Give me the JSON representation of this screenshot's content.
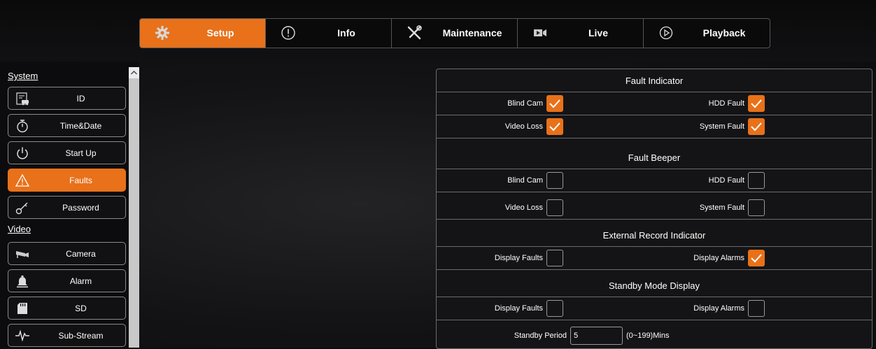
{
  "nav": {
    "tabs": [
      {
        "label": "Setup",
        "icon": "gear-icon",
        "active": true
      },
      {
        "label": "Info",
        "icon": "info-icon",
        "active": false
      },
      {
        "label": "Maintenance",
        "icon": "tools-icon",
        "active": false
      },
      {
        "label": "Live",
        "icon": "video-camera-icon",
        "active": false
      },
      {
        "label": "Playback",
        "icon": "play-icon",
        "active": false
      }
    ]
  },
  "sidebar": {
    "section_system": "System",
    "section_video": "Video",
    "items": [
      {
        "label": "ID",
        "icon": "vehicle-id-icon"
      },
      {
        "label": "Time&Date",
        "icon": "stopwatch-icon"
      },
      {
        "label": "Start Up",
        "icon": "power-icon"
      },
      {
        "label": "Faults",
        "icon": "warning-icon",
        "active": true
      },
      {
        "label": "Password",
        "icon": "key-icon"
      },
      {
        "label": "Camera",
        "icon": "cctv-camera-icon"
      },
      {
        "label": "Alarm",
        "icon": "bell-icon"
      },
      {
        "label": "SD",
        "icon": "sd-card-icon"
      },
      {
        "label": "Sub-Stream",
        "icon": "waveform-icon"
      }
    ]
  },
  "panel": {
    "fault_indicator": {
      "title": "Fault Indicator",
      "blind_cam": {
        "label": "Blind Cam",
        "checked": true
      },
      "hdd_fault": {
        "label": "HDD Fault",
        "checked": true
      },
      "video_loss": {
        "label": "Video Loss",
        "checked": true
      },
      "system_fault": {
        "label": "System Fault",
        "checked": true
      }
    },
    "fault_beeper": {
      "title": "Fault Beeper",
      "blind_cam": {
        "label": "Blind Cam",
        "checked": false
      },
      "hdd_fault": {
        "label": "HDD Fault",
        "checked": false
      },
      "video_loss": {
        "label": "Video Loss",
        "checked": false
      },
      "system_fault": {
        "label": "System Fault",
        "checked": false
      }
    },
    "external_record": {
      "title": "External Record Indicator",
      "display_faults": {
        "label": "Display Faults",
        "checked": false
      },
      "display_alarms": {
        "label": "Display Alarms",
        "checked": true
      }
    },
    "standby_mode": {
      "title": "Standby Mode Display",
      "display_faults": {
        "label": "Display Faults",
        "checked": false
      },
      "display_alarms": {
        "label": "Display Alarms",
        "checked": false
      },
      "period_label": "Standby Period",
      "period_value": "5",
      "period_unit": "(0~199)Mins"
    }
  },
  "colors": {
    "accent": "#e8711a",
    "background": "#0c0c0e",
    "border": "#6b6b6b"
  }
}
